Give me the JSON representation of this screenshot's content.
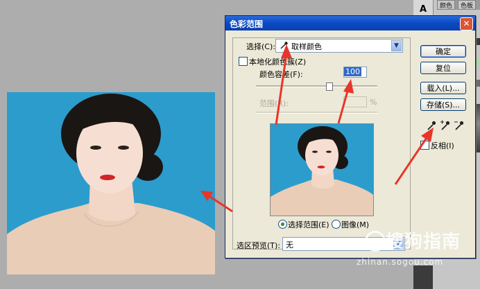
{
  "dialog": {
    "title": "色彩范围",
    "close_glyph": "✕",
    "select_label": "选择(C):",
    "select_value": "取样颜色",
    "localized_label": "本地化颜色簇(Z)",
    "fuzziness_label": "颜色容差(F):",
    "fuzziness_value": "100",
    "range_label": "范围(R):",
    "range_unit": "%",
    "radio_selection": "选择范围(E)",
    "radio_image": "图像(M)",
    "preview_label": "选区预览(T):",
    "preview_value": "无",
    "buttons": {
      "ok": "确定",
      "reset": "复位",
      "load": "载入(L)...",
      "save": "存储(S)..."
    },
    "invert_label": "反相(I)",
    "eyedroppers": [
      "eyedropper-icon",
      "eyedropper-plus-icon",
      "eyedropper-minus-icon"
    ],
    "fuzziness_slider_level": 0.6
  },
  "right_panel": {
    "tabs": [
      "颜色",
      "色板"
    ],
    "text_tool_glyph": "A"
  },
  "watermark": {
    "text": "搜狗指南",
    "url": "zhinan.sogou.com"
  },
  "colors": {
    "canvas_bg": "#adadad",
    "photo_bg": "#2f9fcf",
    "titlebar": "#0a4ac4",
    "arrow": "#e8352b",
    "dialog_bg": "#ece9d8"
  }
}
